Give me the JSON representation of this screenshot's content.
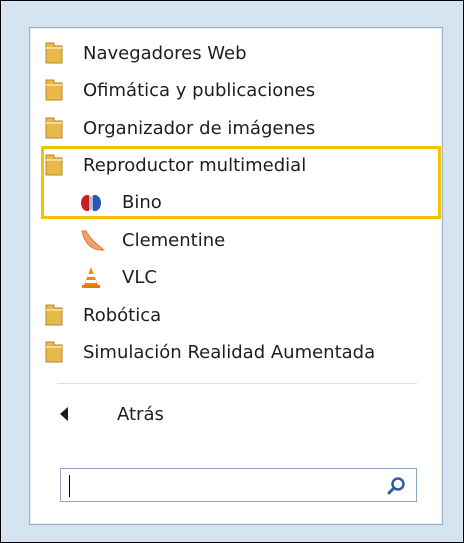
{
  "menu": {
    "items": [
      {
        "label": "Navegadores Web",
        "icon": "folder-icon"
      },
      {
        "label": "Ofimática y publicaciones",
        "icon": "folder-icon"
      },
      {
        "label": "Organizador de imágenes",
        "icon": "folder-icon"
      },
      {
        "label": "Reproductor multimedial",
        "icon": "folder-icon"
      },
      {
        "label": "Bino",
        "icon": "bino-app-icon"
      },
      {
        "label": "Clementine",
        "icon": "clementine-app-icon"
      },
      {
        "label": "VLC",
        "icon": "vlc-cone-icon"
      },
      {
        "label": "Robótica",
        "icon": "folder-icon"
      },
      {
        "label": "Simulación Realidad Aumentada",
        "icon": "folder-icon"
      }
    ],
    "highlight_color": "#f2c400"
  },
  "back": {
    "label": "Atrás",
    "icon": "left-arrow-icon"
  },
  "search": {
    "value": "",
    "placeholder": "",
    "icon": "search-icon"
  },
  "colors": {
    "panel_border": "#9cb3cc",
    "frame_bg": "#d6e4f1"
  }
}
